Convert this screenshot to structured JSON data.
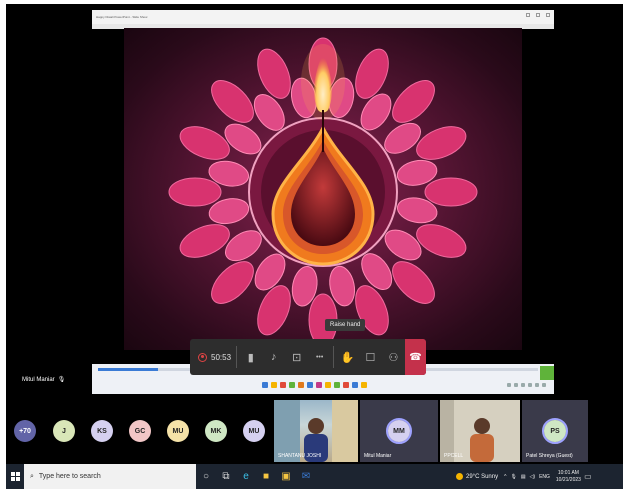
{
  "shared_window": {
    "title": "Happy Diwali PowerPoint - Slide Show"
  },
  "meeting": {
    "timer": "50:53",
    "tooltip": "Raise hand",
    "presenter_name": "Mitul Maniar",
    "colors": {
      "leave": "#c4314b",
      "bar": "#2d2d2d"
    },
    "controls": [
      {
        "name": "camera-off-icon",
        "glyph": "▮"
      },
      {
        "name": "mic-off-icon",
        "glyph": "♪"
      },
      {
        "name": "share-screen-icon",
        "glyph": "⊡"
      },
      {
        "name": "more-options-icon",
        "glyph": "•••"
      },
      {
        "name": "raise-hand-icon",
        "glyph": "✋"
      },
      {
        "name": "chat-icon",
        "glyph": "☐"
      },
      {
        "name": "participants-icon",
        "glyph": "⚇"
      }
    ]
  },
  "participants": {
    "overflow": "+70",
    "avatars": [
      {
        "initials": "J",
        "color": "#d9e6b8"
      },
      {
        "initials": "KS",
        "color": "#d5d0f0"
      },
      {
        "initials": "GC",
        "color": "#f2c6c6"
      },
      {
        "initials": "MU",
        "color": "#f5e2a8"
      },
      {
        "initials": "MK",
        "color": "#cfe7c4"
      },
      {
        "initials": "MU",
        "color": "#d5d0f0"
      }
    ],
    "video_tiles": [
      {
        "name": "SHANTANU JOSHI"
      },
      {
        "initials": "MM",
        "name": "Mitul Maniar"
      },
      {
        "name": "PPCELL"
      },
      {
        "initials": "PS",
        "name": "Patel Shreya (Guest)"
      }
    ]
  },
  "taskbar": {
    "search_placeholder": "Type here to search",
    "weather": "29°C Sunny",
    "language": "ENG",
    "time": "10:01 AM",
    "date": "10/21/2023"
  }
}
